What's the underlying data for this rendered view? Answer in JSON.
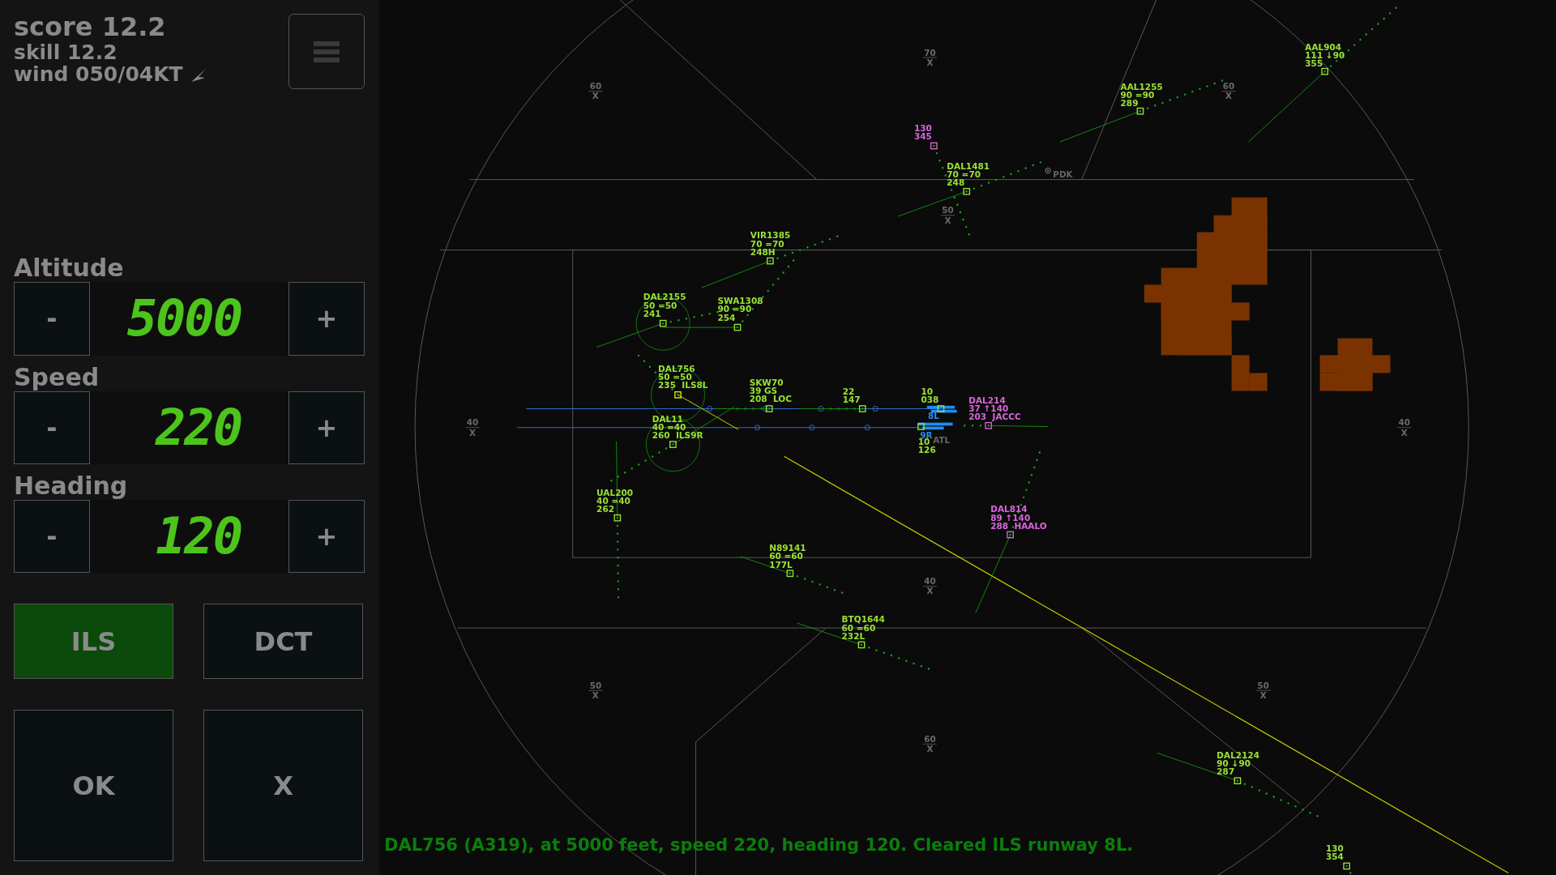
{
  "status": {
    "score": "score 12.2",
    "skill": "skill 12.2",
    "wind": "wind 050/04KT"
  },
  "controls": [
    {
      "label": "Altitude",
      "minus": "-",
      "value": "5000",
      "plus": "+"
    },
    {
      "label": "Speed",
      "minus": "-",
      "value": "220",
      "plus": "+"
    },
    {
      "label": "Heading",
      "minus": "-",
      "value": "120",
      "plus": "+"
    }
  ],
  "modes": [
    {
      "label": "ILS",
      "selected": true
    },
    {
      "label": "DCT",
      "selected": false
    }
  ],
  "actions": [
    "OK",
    "X"
  ],
  "radar": {
    "fixes": [
      {
        "altitude": "60",
        "symbol": "X"
      },
      {
        "altitude": "70",
        "symbol": "X"
      },
      {
        "altitude": "60",
        "symbol": "X"
      },
      {
        "altitude": "50",
        "symbol": "X"
      },
      {
        "altitude": "40",
        "symbol": "X"
      },
      {
        "altitude": "40",
        "symbol": "X"
      },
      {
        "altitude": "40",
        "symbol": "X"
      },
      {
        "altitude": "50",
        "symbol": "X"
      },
      {
        "altitude": "50",
        "symbol": "X"
      },
      {
        "altitude": "60",
        "symbol": "X"
      }
    ],
    "airports": [
      "PDK",
      "ATL"
    ],
    "runways": [
      "8L",
      "9R"
    ],
    "aircraft": [
      {
        "lines": [
          "AAL904",
          "111 ↓90",
          "355"
        ],
        "color": "#99e233",
        "selected": false,
        "ringed": false
      },
      {
        "lines": [
          "AAL1255",
          "90 =90",
          "289"
        ],
        "color": "#99e233",
        "selected": false,
        "ringed": false
      },
      {
        "lines": [
          "130",
          "345"
        ],
        "color": "#d966dd",
        "selected": false,
        "ringed": false
      },
      {
        "lines": [
          "DAL1481",
          "70 =70",
          "248"
        ],
        "color": "#99e233",
        "selected": false,
        "ringed": false
      },
      {
        "lines": [
          "VIR1385",
          "70 =70",
          "248H"
        ],
        "color": "#99e233",
        "selected": false,
        "ringed": false
      },
      {
        "lines": [
          "DAL2155",
          "50 =50",
          "241"
        ],
        "color": "#99e233",
        "selected": false,
        "ringed": true
      },
      {
        "lines": [
          "SWA1308",
          "90 =90",
          "254"
        ],
        "color": "#99e233",
        "selected": false,
        "ringed": false
      },
      {
        "lines": [
          "DAL756",
          "50 =50",
          "235  ILS8L"
        ],
        "color": "#99e233",
        "selected": true,
        "ringed": true
      },
      {
        "lines": [
          "SKW70",
          "39 GS",
          "208  LOC"
        ],
        "color": "#99e233",
        "selected": false,
        "ringed": false
      },
      {
        "lines": [
          "22",
          "147"
        ],
        "color": "#99e233",
        "selected": false,
        "ringed": false
      },
      {
        "lines": [
          "10",
          "038"
        ],
        "color": "#99e233",
        "selected": false,
        "ringed": false
      },
      {
        "lines": [
          "DAL214",
          "37 ↑140",
          "203  JACCC"
        ],
        "color": "#d966dd",
        "selected": false,
        "ringed": false
      },
      {
        "lines": [
          "DAL11",
          "40 =40",
          "260  ILS9R"
        ],
        "color": "#99e233",
        "selected": false,
        "ringed": true
      },
      {
        "lines": [
          "10",
          "126"
        ],
        "color": "#99e233",
        "selected": false,
        "ringed": false
      },
      {
        "lines": [
          "UAL200",
          "40 =40",
          "262"
        ],
        "color": "#99e233",
        "selected": false,
        "ringed": false
      },
      {
        "lines": [
          "DAL814",
          "89 ↑140",
          "288  HAALO"
        ],
        "color": "#d966dd",
        "selected": false,
        "ringed": false
      },
      {
        "lines": [
          "N89141",
          "60 =60",
          "177L"
        ],
        "color": "#99e233",
        "selected": false,
        "ringed": false
      },
      {
        "lines": [
          "BTQ1644",
          "60 =60",
          "232L"
        ],
        "color": "#99e233",
        "selected": false,
        "ringed": false
      },
      {
        "lines": [
          "DAL2124",
          "90 ↓90",
          "287"
        ],
        "color": "#99e233",
        "selected": false,
        "ringed": false
      },
      {
        "lines": [
          "130",
          "354"
        ],
        "color": "#99e233",
        "selected": false,
        "ringed": false
      }
    ]
  },
  "message": "DAL756 (A319), at 5000 feet, speed 220, heading 120. Cleared ILS runway 8L."
}
